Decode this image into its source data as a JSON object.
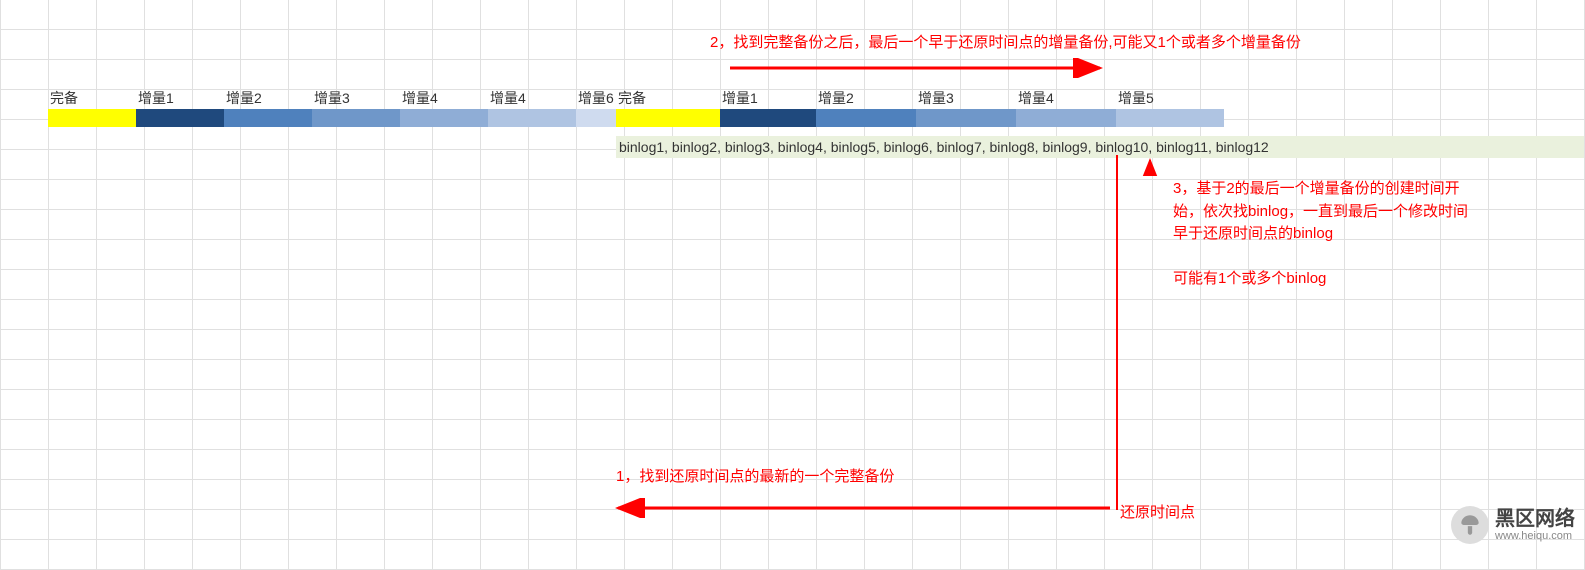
{
  "headers": {
    "set1": [
      "完备",
      "增量1",
      "增量2",
      "增量3",
      "增量4",
      "增量4",
      "增量6"
    ],
    "set2": [
      "完备",
      "增量1",
      "增量2",
      "增量3",
      "增量4",
      "增量5"
    ]
  },
  "colors": {
    "set1": [
      "#ffff00",
      "#1f497d",
      "#4f81bd",
      "#6f97c9",
      "#8fadd6",
      "#afc4e2",
      "#cfdbef"
    ],
    "set2": [
      "#ffff00",
      "#1f497d",
      "#4f81bd",
      "#6f97c9",
      "#8fadd6",
      "#afc4e2",
      "#cfdbef"
    ]
  },
  "binlogs": "binlog1, binlog2, binlog3, binlog4, binlog5, binlog6, binlog7, binlog8, binlog9, binlog10, binlog11, binlog12",
  "annotations": {
    "note2": "2，找到完整备份之后，最后一个早于还原时间点的增量备份,可能又1个或者多个增量备份",
    "note3_line1": "3，基于2的最后一个增量备份的创建时间开",
    "note3_line2": "始，依次找binlog，一直到最后一个修改时间",
    "note3_line3": "早于还原时间点的binlog",
    "note3_line4": "可能有1个或多个binlog",
    "note1": "1，找到还原时间点的最新的一个完整备份",
    "restore_point": "还原时间点"
  },
  "logo": {
    "cn": "黑区网络",
    "en": "www.heiqu.com"
  }
}
